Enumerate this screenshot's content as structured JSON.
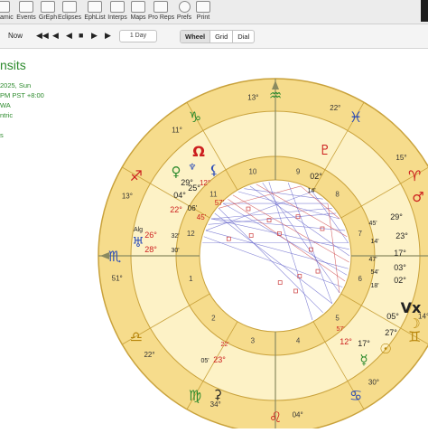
{
  "toolbar": {
    "items": [
      {
        "label": "amic"
      },
      {
        "label": "Events"
      },
      {
        "label": "GrEph"
      },
      {
        "label": "Eclipses"
      },
      {
        "label": "EphList"
      },
      {
        "label": "Interps"
      },
      {
        "label": "Maps"
      },
      {
        "label": "Pro Reps"
      },
      {
        "label": "Prefs"
      },
      {
        "label": "Print"
      }
    ]
  },
  "nav": {
    "now_label": "Now",
    "step_value": "1 Day",
    "view_modes": [
      "Wheel",
      "Grid",
      "Dial"
    ],
    "active_view": "Wheel"
  },
  "info_panel": {
    "title": "nsits",
    "lines": [
      "2025, Sun",
      "PM PST +8:00",
      "WA",
      "ntric",
      "",
      "s"
    ]
  },
  "colors": {
    "zodiac_ring": "#f6dc8c",
    "ring_border": "#c9a23c",
    "house_ring": "#fdf2c6",
    "text_red": "#cc1e1e",
    "text_green": "#2e8b2e",
    "aspect_blue": "#5c5cc8",
    "aspect_red": "#cc3c3c"
  },
  "chart": {
    "sign_ring": [
      {
        "name": "aquarius",
        "glyph": "♒",
        "color": "#2e8b2e"
      },
      {
        "name": "pisces",
        "glyph": "♓",
        "color": "#2e4fb8"
      },
      {
        "name": "aries",
        "glyph": "♈",
        "color": "#cc1e1e"
      },
      {
        "name": "taurus",
        "glyph": "♉",
        "color": "#2e8b2e"
      },
      {
        "name": "gemini",
        "glyph": "♊",
        "color": "#b8860b"
      },
      {
        "name": "cancer",
        "glyph": "♋",
        "color": "#2e4fb8"
      },
      {
        "name": "leo",
        "glyph": "♌",
        "color": "#cc1e1e"
      },
      {
        "name": "virgo",
        "glyph": "♍",
        "color": "#2e8b2e"
      },
      {
        "name": "libra",
        "glyph": "♎",
        "color": "#b8860b"
      },
      {
        "name": "scorpio",
        "glyph": "♏",
        "color": "#2e4fb8"
      },
      {
        "name": "sagittarius",
        "glyph": "♐",
        "color": "#cc1e1e"
      },
      {
        "name": "capricorn",
        "glyph": "♑",
        "color": "#2e8b2e"
      }
    ],
    "cusp_degrees": [
      "13°",
      "22°",
      "15°",
      "25°",
      "14°",
      "30°",
      "04°",
      "34°",
      "22°",
      "51°",
      "13°",
      "11°"
    ],
    "house_numbers": [
      "1",
      "2",
      "3",
      "4",
      "5",
      "6",
      "7",
      "8",
      "9",
      "10",
      "11",
      "12"
    ],
    "planet_labels": [
      {
        "text": "♆",
        "color": "#2e4fb8"
      },
      {
        "text": "29°",
        "color": "#222222"
      },
      {
        "text": "04°",
        "color": "#222222"
      },
      {
        "text": "25°",
        "color": "#222222"
      },
      {
        "text": "22°",
        "color": "#cc1e1e"
      },
      {
        "text": "12°",
        "color": "#cc1e1e"
      },
      {
        "text": "06'",
        "color": "#222222"
      },
      {
        "text": "45'",
        "color": "#cc1e1e"
      },
      {
        "text": "57'",
        "color": "#cc1e1e"
      },
      {
        "text": "Ω",
        "color": "#cc1e1e"
      },
      {
        "text": "♀",
        "color": "#2e8b2e"
      },
      {
        "text": "⚸",
        "color": "#2e4fb8"
      },
      {
        "text": "♇",
        "color": "#cc1e1e"
      },
      {
        "text": "02°",
        "color": "#222222"
      },
      {
        "text": "14'",
        "color": "#222222"
      },
      {
        "text": "26°",
        "color": "#cc1e1e"
      },
      {
        "text": "28°",
        "color": "#cc1e1e"
      },
      {
        "text": "32'",
        "color": "#222222"
      },
      {
        "text": "30'",
        "color": "#222222"
      },
      {
        "text": "Alg",
        "color": "#222222"
      },
      {
        "text": "♅",
        "color": "#2e4fb8"
      },
      {
        "text": "♂",
        "color": "#cc1e1e"
      },
      {
        "text": "29°",
        "color": "#222222"
      },
      {
        "text": "23°",
        "color": "#222222"
      },
      {
        "text": "17°",
        "color": "#222222"
      },
      {
        "text": "03°",
        "color": "#222222"
      },
      {
        "text": "02°",
        "color": "#222222"
      },
      {
        "text": "45'",
        "color": "#222222"
      },
      {
        "text": "14'",
        "color": "#222222"
      },
      {
        "text": "47'",
        "color": "#222222"
      },
      {
        "text": "54'",
        "color": "#222222"
      },
      {
        "text": "18'",
        "color": "#222222"
      },
      {
        "text": "05°",
        "color": "#222222"
      },
      {
        "text": "27°",
        "color": "#222222"
      },
      {
        "text": "Vx",
        "color": "#222222"
      },
      {
        "text": "☽",
        "color": "#b8860b"
      },
      {
        "text": "☉",
        "color": "#b8860b"
      },
      {
        "text": "☿",
        "color": "#2e8b2e"
      },
      {
        "text": "17°",
        "color": "#222222"
      },
      {
        "text": "12°",
        "color": "#cc1e1e"
      },
      {
        "text": "57'",
        "color": "#cc1e1e"
      },
      {
        "text": "22'",
        "color": "#cc1e1e"
      },
      {
        "text": "23°",
        "color": "#cc1e1e"
      },
      {
        "text": "05'",
        "color": "#222222"
      },
      {
        "text": "⚳",
        "color": "#222222"
      }
    ]
  }
}
